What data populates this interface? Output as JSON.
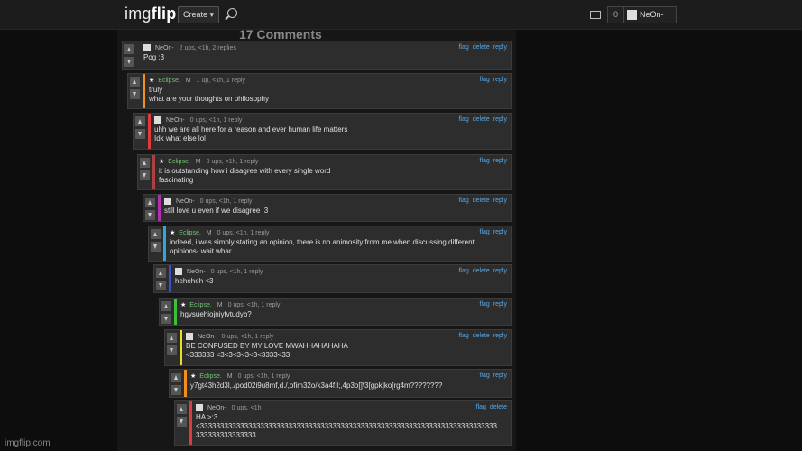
{
  "header": {
    "logo_a": "img",
    "logo_b": "flip",
    "create_label": "Create ▾",
    "notif_count": "0",
    "username": "NeOn-"
  },
  "heading": "17 Comments",
  "watermark": "imgflip.com",
  "comments": [
    {
      "user": "NeOn-",
      "kind": "neon",
      "meta": "2 ups, <1h, 2 replies",
      "actions": [
        "flag",
        "delete",
        "reply"
      ],
      "lines": [
        "Pog :3"
      ],
      "bar": "#2d2d2d"
    },
    {
      "user": "Eclipse.",
      "kind": "ecl",
      "meta": "1 up, <1h, 1 reply",
      "actions": [
        "flag",
        "reply"
      ],
      "lines": [
        "truly",
        "what are your thoughts on philosophy"
      ],
      "bar": "#f0901e"
    },
    {
      "user": "NeOn-",
      "kind": "neon",
      "meta": "0 ups, <1h, 1 reply",
      "actions": [
        "flag",
        "delete",
        "reply"
      ],
      "lines": [
        "uhh we are all here for a reason and ever human life matters",
        "Idk what else lol"
      ],
      "bar": "#e03a3a"
    },
    {
      "user": "Eclipse.",
      "kind": "ecl",
      "meta": "0 ups, <1h, 1 reply",
      "actions": [
        "flag",
        "reply"
      ],
      "lines": [
        "it is outstanding how i disagree with every single word",
        "fascinating"
      ],
      "bar": "#b04040"
    },
    {
      "user": "NeOn-",
      "kind": "neon",
      "meta": "0 ups, <1h, 1 reply",
      "actions": [
        "flag",
        "delete",
        "reply"
      ],
      "lines": [
        "still love u even if we disagree :3"
      ],
      "bar": "#b030b0"
    },
    {
      "user": "Eclipse.",
      "kind": "ecl",
      "meta": "0 ups, <1h, 1 reply",
      "actions": [
        "flag",
        "reply"
      ],
      "lines": [
        "indeed, i was simply stating an opinion, there is no animosity from me when discussing different",
        "opinions- wait whar"
      ],
      "bar": "#2ea7e0"
    },
    {
      "user": "NeOn-",
      "kind": "neon",
      "meta": "0 ups, <1h, 1 reply",
      "actions": [
        "flag",
        "delete",
        "reply"
      ],
      "lines": [
        "heheheh <3"
      ],
      "bar": "#3a4fd0"
    },
    {
      "user": "Eclipse.",
      "kind": "ecl",
      "meta": "0 ups, <1h, 1 reply",
      "actions": [
        "flag",
        "reply"
      ],
      "lines": [
        "hgvsuehiojniyfvtudyb?"
      ],
      "bar": "#3cc03c"
    },
    {
      "user": "NeOn-",
      "kind": "neon",
      "meta": "0 ups, <1h, 1 reply",
      "actions": [
        "flag",
        "delete",
        "reply"
      ],
      "lines": [
        "BE CONFUSED BY MY LOVE MWAHHAHAHAHA",
        "<333333 <3<3<3<3<3<3333<33"
      ],
      "bar": "#e8e020"
    },
    {
      "user": "Eclipse.",
      "kind": "ecl",
      "meta": "0 ups, <1h, 1 reply",
      "actions": [
        "flag",
        "reply"
      ],
      "lines": [
        "y7gt43h2d3l,./pod02i9u8mf,d./,ofim32o/k3a4f.l;,4p3o[]\\3[gpk]ko[rg4m????????"
      ],
      "bar": "#f0901e"
    },
    {
      "user": "NeOn-",
      "kind": "neon",
      "meta": "0 ups, <1h",
      "actions": [
        "flag",
        "delete"
      ],
      "lines": [
        "HA >:3",
        "<33333333333333333333333333333333333333333333333333333333333333333333333333",
        "333333333333333"
      ],
      "bar": "#e03a3a"
    }
  ]
}
